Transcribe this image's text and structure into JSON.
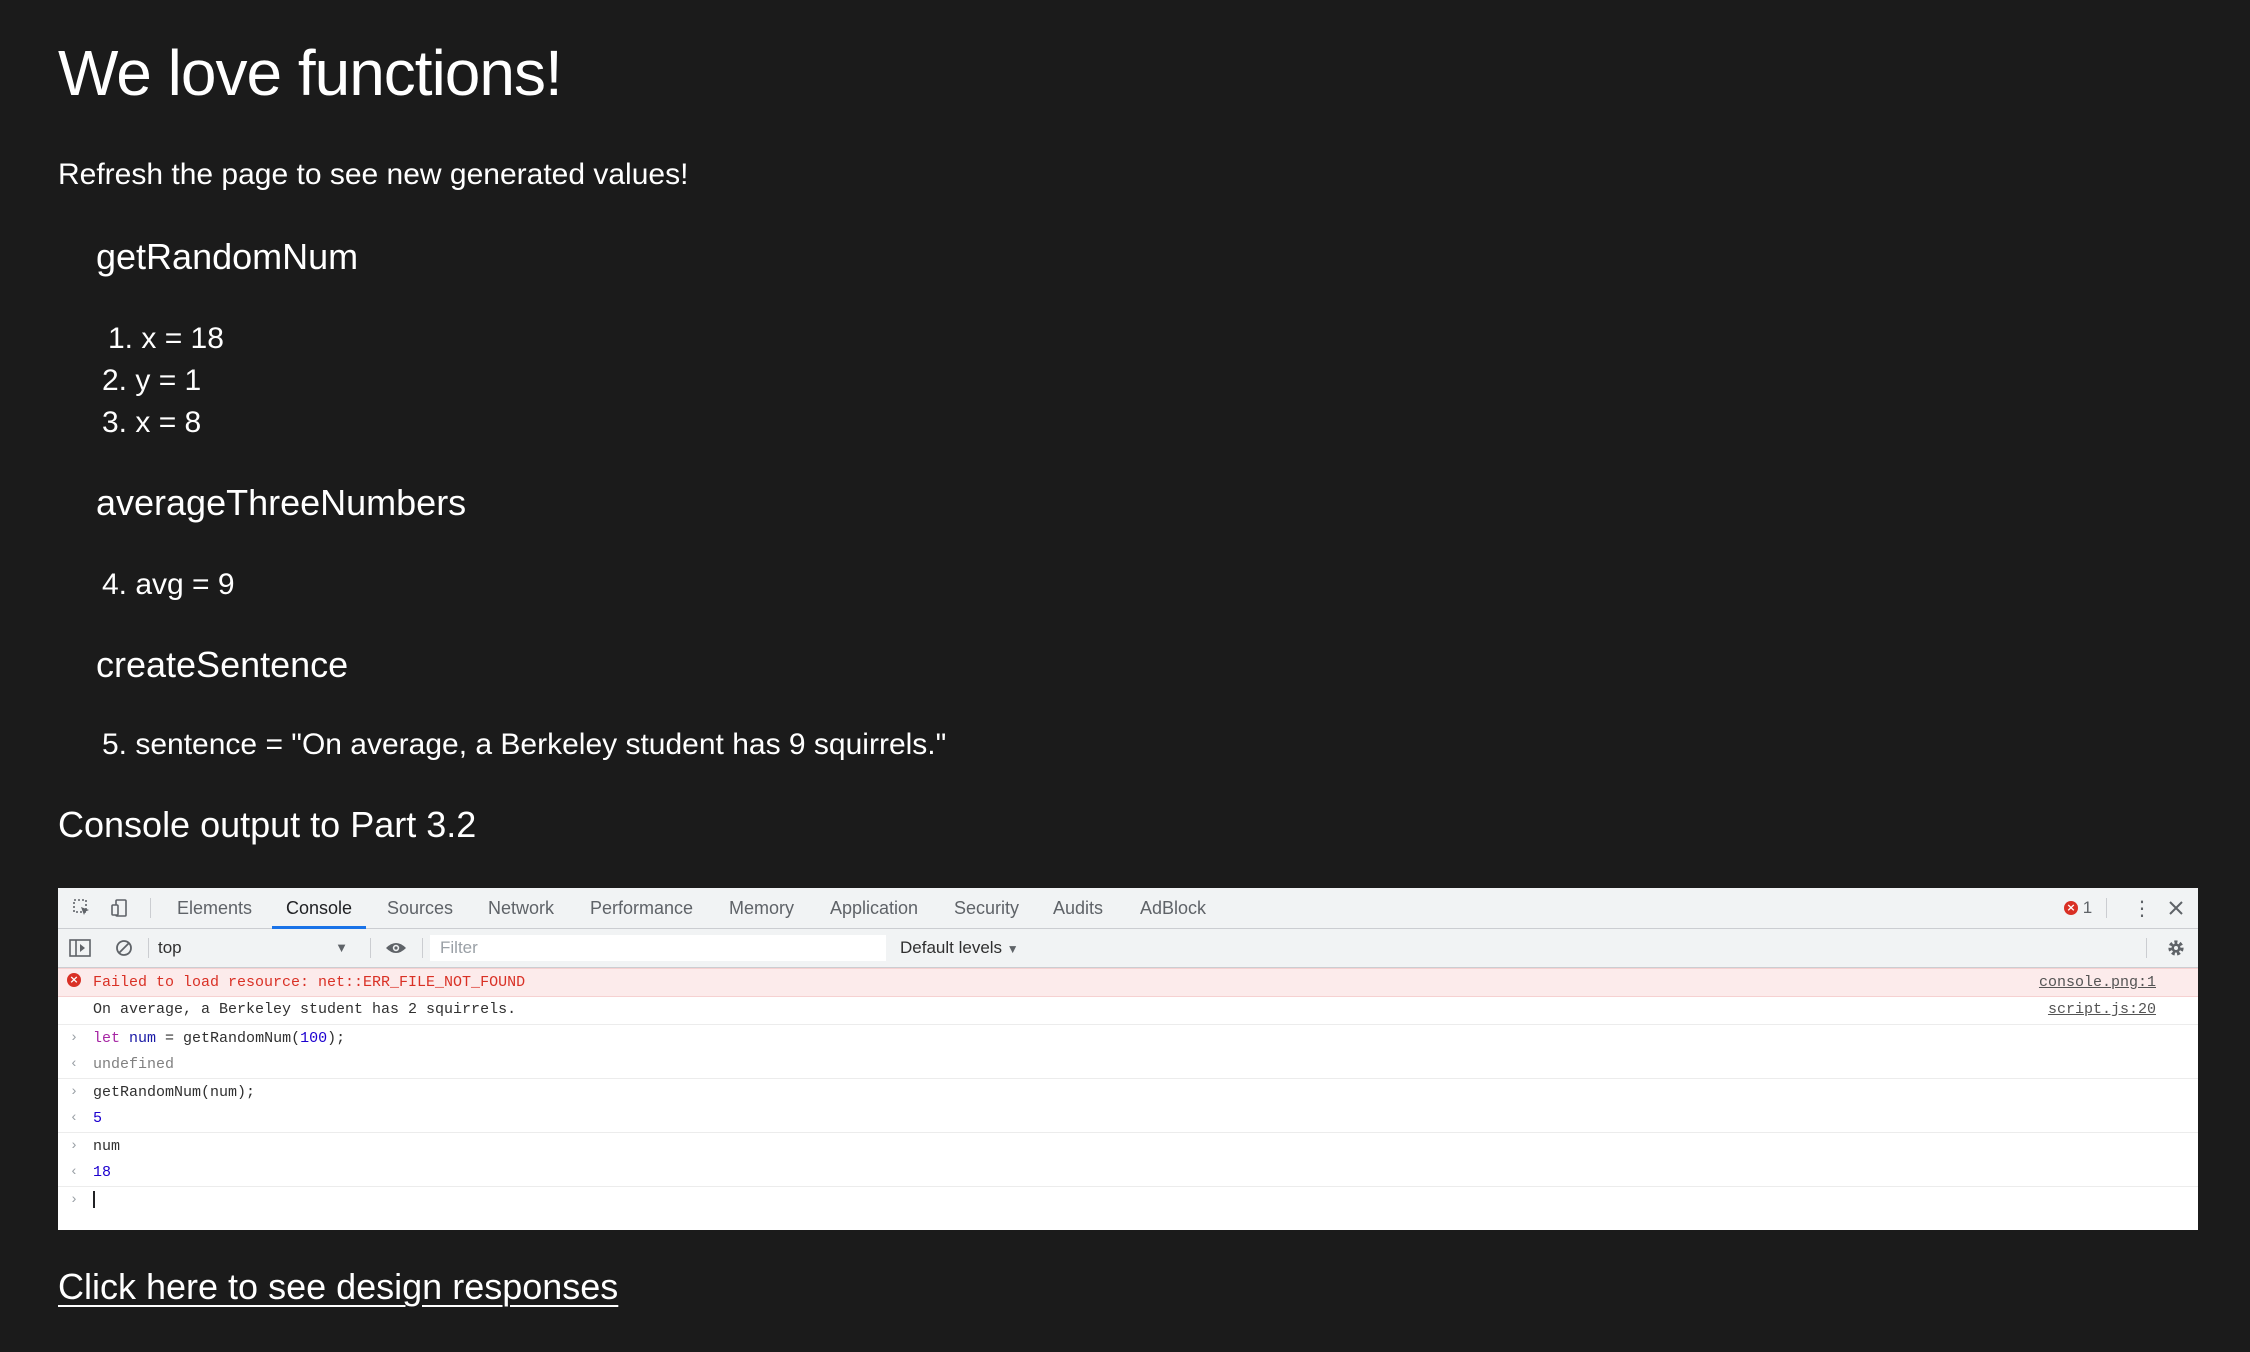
{
  "page": {
    "title": "We love functions!",
    "lede": "Refresh the page to see new generated values!",
    "sections": [
      {
        "heading": "getRandomNum",
        "items": [
          "1. x = 18",
          "2. y = 1",
          "3. x = 8"
        ]
      },
      {
        "heading": "averageThreeNumbers",
        "items": [
          "4. avg = 9"
        ]
      },
      {
        "heading": "createSentence",
        "items": [
          "5. sentence = \"On average, a Berkeley student has 9 squirrels.\""
        ]
      }
    ],
    "console_heading": "Console output to Part 3.2",
    "link_text": "Click here to see design responses"
  },
  "devtools": {
    "tabs": [
      "Elements",
      "Console",
      "Sources",
      "Network",
      "Performance",
      "Memory",
      "Application",
      "Security",
      "Audits",
      "AdBlock"
    ],
    "active_tab": "Console",
    "error_count": "1",
    "context": "top",
    "filter_placeholder": "Filter",
    "levels": "Default levels",
    "messages": {
      "error_text": "Failed to load resource: net::ERR_FILE_NOT_FOUND",
      "error_source": "console.png:1",
      "log_text": "On average, a Berkeley student has 2 squirrels.",
      "log_source": "script.js:20",
      "cmd1_kw": "let",
      "cmd1_var": "num",
      "cmd1_mid": " = getRandomNum(",
      "cmd1_arg": "100",
      "cmd1_end": ");",
      "res1": "undefined",
      "cmd2": "getRandomNum(num);",
      "res2": "5",
      "cmd3": "num",
      "res3": "18"
    }
  },
  "colors": {
    "page_bg": "#1b1b1b",
    "text": "#ffffff",
    "error_red": "#d93025",
    "active_tab_blue": "#1a73e8"
  }
}
